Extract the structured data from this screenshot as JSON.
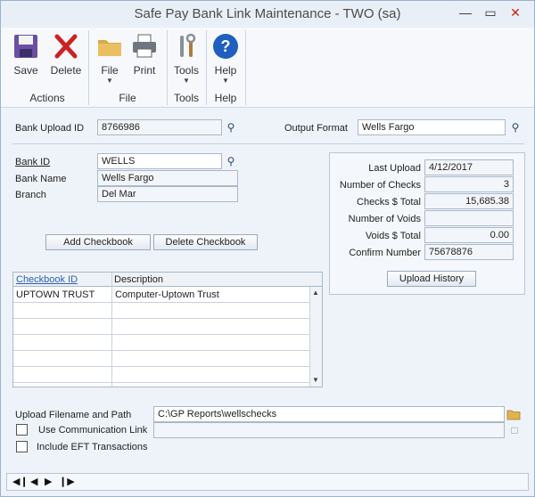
{
  "window": {
    "title": "Safe Pay Bank Link Maintenance  -  TWO (sa)",
    "minimize": "—",
    "maximize": "▭",
    "close": "✕"
  },
  "ribbon": {
    "buttons": [
      {
        "label": "Save"
      },
      {
        "label": "Delete"
      },
      {
        "label": "File",
        "arrow": "▼"
      },
      {
        "label": "Print"
      },
      {
        "label": "Tools",
        "arrow": "▼"
      },
      {
        "label": "Help",
        "arrow": "▼"
      }
    ],
    "groups": [
      "Actions",
      "File",
      "Tools",
      "Help"
    ]
  },
  "header": {
    "bank_upload_id_label": "Bank Upload ID",
    "bank_upload_id_value": "8766986",
    "output_format_label": "Output Format",
    "output_format_value": "Wells Fargo"
  },
  "bank": {
    "bank_id_label": "Bank ID",
    "bank_id_value": "WELLS",
    "bank_name_label": "Bank Name",
    "bank_name_value": "Wells Fargo",
    "branch_label": "Branch",
    "branch_value": "Del Mar"
  },
  "summary": {
    "rows": [
      {
        "label": "Last Upload",
        "value": "4/12/2017",
        "align": "left"
      },
      {
        "label": "Number of Checks",
        "value": "3",
        "align": "right"
      },
      {
        "label": "Checks $ Total",
        "value": "15,685.38",
        "align": "right"
      },
      {
        "label": "Number of Voids",
        "value": "",
        "align": "right"
      },
      {
        "label": "Voids $ Total",
        "value": "0.00",
        "align": "right"
      },
      {
        "label": "Confirm Number",
        "value": "75678876",
        "align": "left"
      }
    ],
    "upload_history_label": "Upload History"
  },
  "checkbook_buttons": {
    "add": "Add Checkbook",
    "delete": "Delete Checkbook"
  },
  "grid": {
    "columns": [
      "Checkbook ID",
      "Description"
    ],
    "rows": [
      {
        "id": "UPTOWN TRUST",
        "description": "Computer-Uptown Trust"
      },
      {
        "id": "",
        "description": ""
      },
      {
        "id": "",
        "description": ""
      },
      {
        "id": "",
        "description": ""
      },
      {
        "id": "",
        "description": ""
      },
      {
        "id": "",
        "description": ""
      }
    ]
  },
  "upload": {
    "path_label": "Upload Filename and Path",
    "path_value": "C:\\GP Reports\\wellschecks",
    "use_comm_link_label": "Use Communication Link",
    "use_comm_link_checked": false,
    "include_eft_label": "Include EFT Transactions",
    "include_eft_checked": false
  },
  "colors": {
    "accent": "#2b5fb3",
    "delete_red": "#cc2222",
    "help_blue": "#1f5fbf"
  }
}
